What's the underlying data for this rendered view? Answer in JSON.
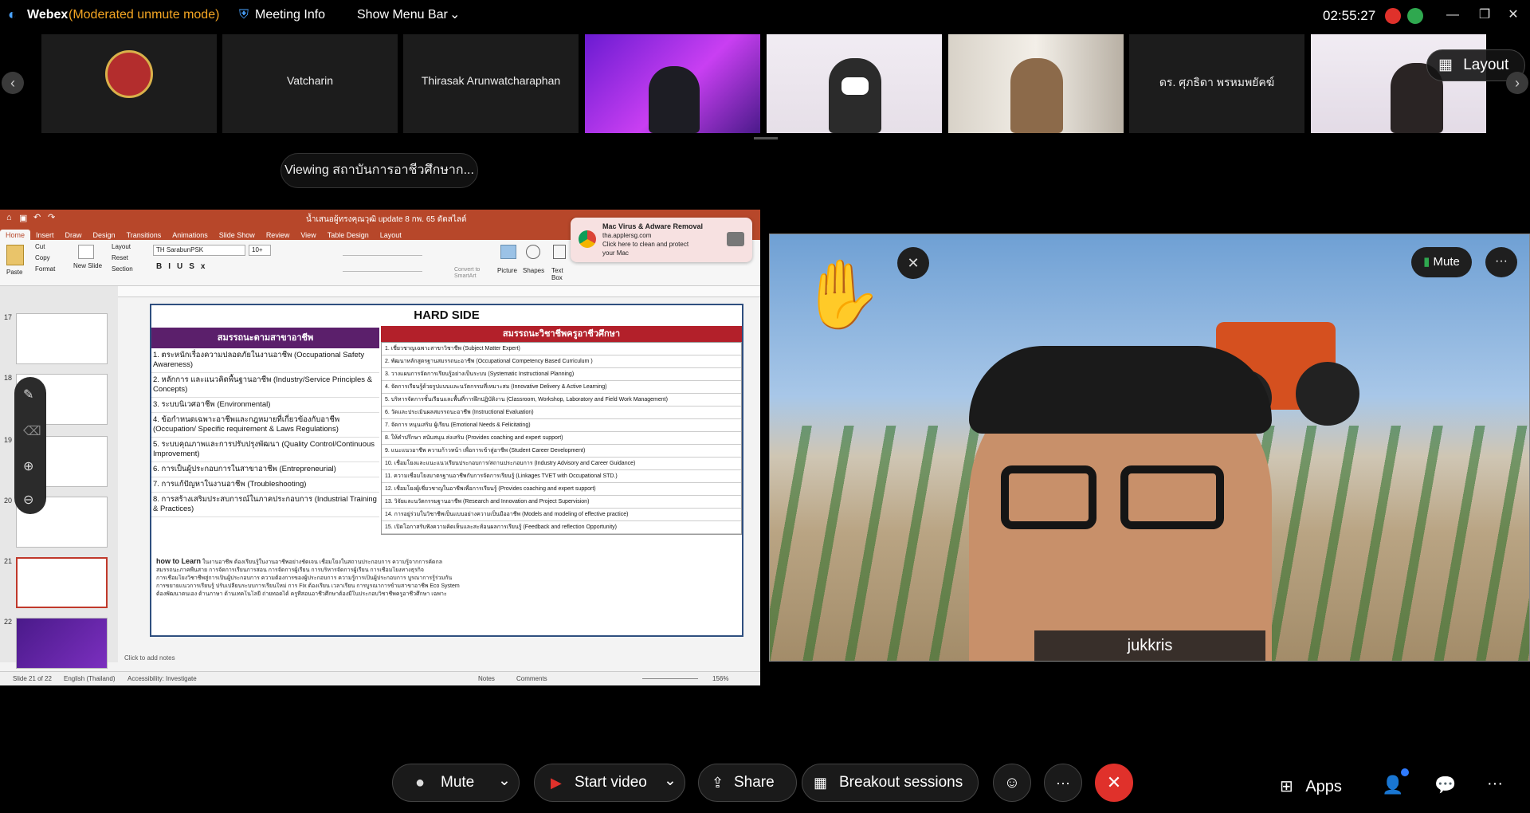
{
  "titlebar": {
    "app_name": "Webex",
    "mode": "(Moderated unmute mode)",
    "meeting_info": "Meeting Info",
    "show_menu_bar": "Show Menu Bar",
    "clock": "02:55:27"
  },
  "participants": [
    {
      "name": ""
    },
    {
      "name": "Vatcharin"
    },
    {
      "name": "Thirasak Arunwatcharaphan"
    },
    {
      "name": ""
    },
    {
      "name": ""
    },
    {
      "name": ""
    },
    {
      "name": "ดร. ศุภธิดา พรหมพยัคฆ์"
    },
    {
      "name": ""
    }
  ],
  "layout_button": "Layout",
  "viewing": "Viewing สถาบันการอาชีวศึกษาก...",
  "ppt": {
    "file_title": "น้ำเสนอผู้ทรงคุณวุฒิ update 8 กพ. 65 ดัดสไลด์",
    "tabs": [
      "Home",
      "Insert",
      "Draw",
      "Design",
      "Transitions",
      "Animations",
      "Slide Show",
      "Review",
      "View",
      "Table Design",
      "Layout"
    ],
    "ribbon": {
      "paste": "Paste",
      "cut": "Cut",
      "copy": "Copy",
      "format": "Format",
      "new_slide": "New Slide",
      "layout": "Layout",
      "reset": "Reset",
      "section": "Section",
      "font": "TH SarabunPSK",
      "size": "10+",
      "picture": "Picture",
      "shapes": "Shapes",
      "text_box": "Text Box",
      "convert": "Convert to SmartArt"
    },
    "thumb_numbers": [
      "17",
      "18",
      "19",
      "20",
      "21",
      "22"
    ],
    "status_left": "Slide 21 of 22",
    "status_lang": "English (Thailand)",
    "status_access": "Accessibility: Investigate",
    "status_notes": "Notes",
    "status_comments": "Comments",
    "status_zoom": "156%",
    "notes_placeholder": "Click to add notes"
  },
  "slide": {
    "title": "HARD SIDE",
    "left_header": "สมรรถนะตามสาขาอาชีพ",
    "right_header": "สมรรถนะวิชาชีพครูอาชีวศึกษา",
    "left_items": [
      "1. ตระหนักเรื่องความปลอดภัยในงานอาชีพ (Occupational Safety Awareness)",
      "2. หลักการ และแนวคิดพื้นฐานอาชีพ (Industry/Service Principles & Concepts)",
      "3. ระบบนิเวศอาชีพ (Environmental)",
      "4. ข้อกำหนดเฉพาะอาชีพและกฎหมายที่เกี่ยวข้องกับอาชีพ (Occupation/ Specific requirement & Laws Regulations)",
      "5. ระบบคุณภาพและการปรับปรุงพัฒนา (Quality Control/Continuous Improvement)",
      "6. การเป็นผู้ประกอบการในสาขาอาชีพ (Entrepreneurial)",
      "7. การแก้ปัญหาในงานอาชีพ (Troubleshooting)",
      "8. การสร้างเสริมประสบการณ์ในภาคประกอบการ (Industrial Training & Practices)"
    ],
    "right_items": [
      "1. เชี่ยวชาญเฉพาะสาขาวิชาชีพ (Subject Matter Expert)",
      "2. พัฒนาหลักสูตรฐานสมรรถนะอาชีพ (Occupational Competency Based Curriculum )",
      "3. วางแผนการจัดการเรียนรู้อย่างเป็นระบบ (Systematic Instructional Planning)",
      "4. จัดการเรียนรู้ด้วยรูปแบบและนวัตกรรมที่เหมาะสม (Innovative Delivery & Active Learning)",
      "5. บริหารจัดการชั้นเรียนและพื้นที่การฝึกปฏิบัติงาน (Classroom, Workshop, Laboratory and Field Work Management)",
      "6. วัดและประเมินผลสมรรถนะอาชีพ (Instructional Evaluation)",
      "7. จัดการ หนุนเสริม ผู้เรียน (Emotional Needs & Felicitating)",
      "8. ให้คำปรึกษา สนับสนุน ส่งเสริม (Provides coaching and expert support)",
      "9. แนะแนวอาชีพ ความก้าวหน้า เพื่อการเข้าสู่อาชีพ (Student Career Development)",
      "10. เชื่อมโยงและแนะแนวเรียนประกอบการ/สถานประกอบการ (Industry Advisory and Career Guidance)",
      "11. ความเชื่อมโยงมาตรฐานอาชีพกับการจัดการเรียนรู้ (Linkages TVET with Occupational STD.)",
      "12. เชื่อมโยงผู้เชี่ยวชาญในอาชีพเพื่อการเรียนรู้ (Provides coaching and expert support)",
      "13. วิจัยและนวัตกรรมฐานอาชีพ (Research and Innovation and Project Supervision)",
      "14. การอยู่ร่วมในวิชาชีพเป็นแบบอย่างความเป็นมืออาชีพ (Models and modeling of effective practice)",
      "15. เปิดโอกาสรับฟังความคิดเห็นและสะท้อนผลการเรียนรู้ (Feedback and reflection Opportunity)"
    ],
    "how_label": "how to Learn",
    "how_lines": [
      "ในงานอาชีพ ต้องเรียนรู้ในงานอาชีพอย่างชัดเจน เชื่อมโยงในสถานประกอบการ ความรู้จากการคัดกล",
      "สมรรถนะภาคพื้นสาย การจัดการเรียนการสอน การจัดการผู้เรียน การบริหารจัดการผู้เรียน การเชื่อมโยงทางธุรกิจ",
      "การเชื่อมโยงวิชาชีพสู่การเป็นผู้ประกอบการ ความต้องการของผู้ประกอบการ ความรู้การเป็นผู้ประกอบการ บูรณาการรู้ร่วมกัน",
      "การขยายแนวการเรียนรู้ ปรับเปลี่ยนระบบการเรียนใหม่ การ Fix ต้องเรียน เวลาเรียน การบูรณาการข้ามสาขาอาชีพ Eco System",
      "ต้องพัฒนาตนเอง ด้านภาษา ด้านเทคโนโลยี ถ่ายทอดได้ ครูที่สอนอาชีวศึกษาต้องมีในประกอบวิชาชีพครูอาชีวศึกษา เฉพาะ"
    ]
  },
  "ad": {
    "title": "Mac Virus & Adware Removal",
    "domain": "tha.applersg.com",
    "line1": "Click here to clean and protect",
    "line2": "your Mac"
  },
  "video": {
    "speaker": "jukkris",
    "mute": "Mute"
  },
  "controls": {
    "mute": "Mute",
    "start_video": "Start video",
    "share": "Share",
    "breakout": "Breakout sessions",
    "apps": "Apps"
  },
  "colors": {
    "webex_yellow": "#f5a623",
    "end_call": "#e0312b",
    "ppt_red": "#b7472a",
    "slide_purple": "#5b1f6b",
    "slide_red": "#b3202a"
  }
}
